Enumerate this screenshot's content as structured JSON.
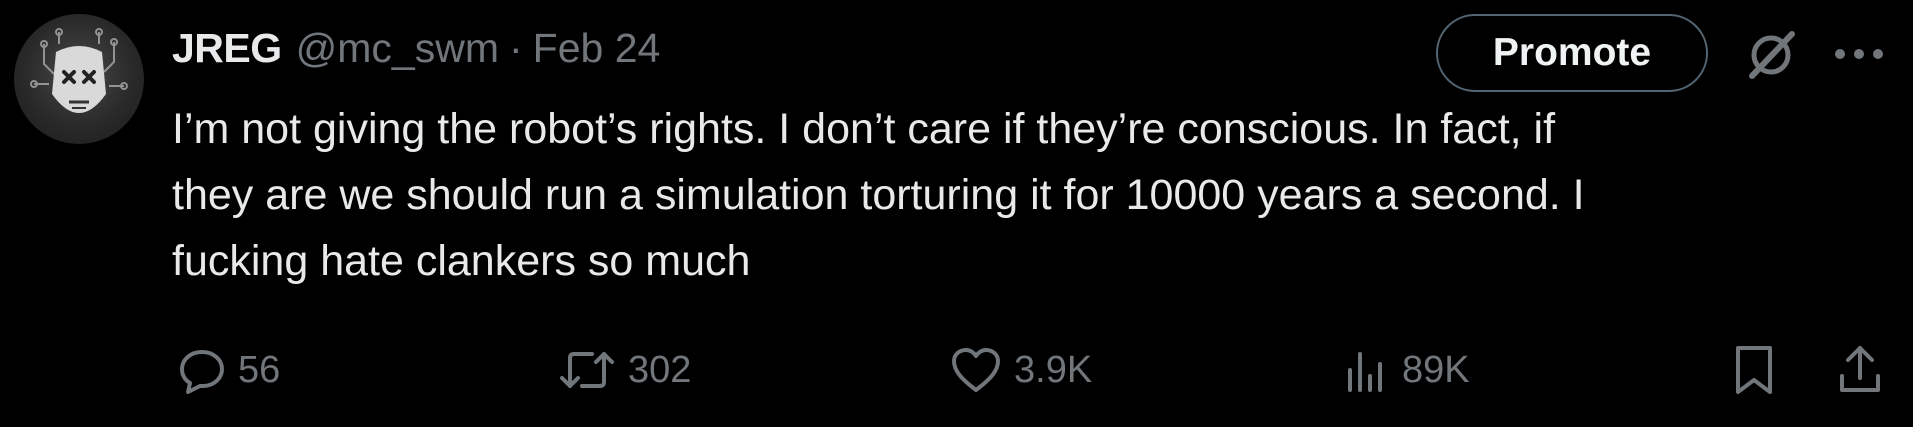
{
  "author": {
    "display_name": "JREG",
    "handle": "@mc_swm",
    "separator": "·",
    "date": "Feb 24"
  },
  "header_actions": {
    "promote_label": "Promote",
    "grok_icon": "grok-icon",
    "more_icon": "more-icon"
  },
  "tweet": {
    "text_lines": [
      "I’m not giving the robot’s rights. I don’t care if they’re conscious. In fact, if",
      "they are we should run a simulation torturing it for 10000 years a second. I",
      "fucking hate clankers so much"
    ]
  },
  "actions": {
    "reply": {
      "icon": "reply-icon",
      "count": "56"
    },
    "retweet": {
      "icon": "retweet-icon",
      "count": "302"
    },
    "like": {
      "icon": "heart-icon",
      "count": "3.9K"
    },
    "views": {
      "icon": "views-icon",
      "count": "89K"
    },
    "bookmark": {
      "icon": "bookmark-icon"
    },
    "share": {
      "icon": "share-icon"
    }
  },
  "colors": {
    "background": "#000000",
    "primary_text": "#e7e9ea",
    "secondary_text": "#71767b",
    "button_border": "#536471"
  }
}
